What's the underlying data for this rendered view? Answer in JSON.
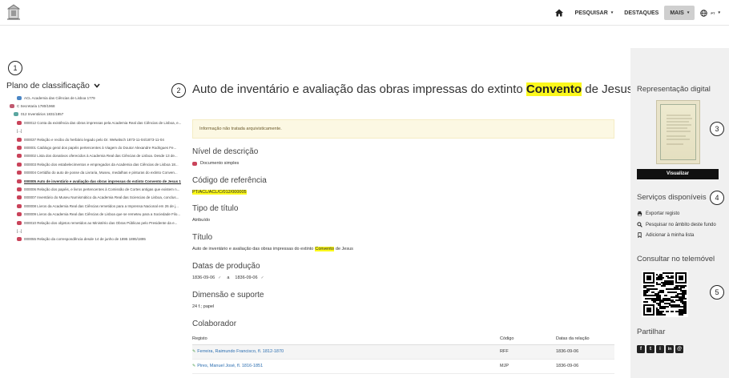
{
  "nav": {
    "items": [
      {
        "label": "PESQUISAR",
        "caret": "▾"
      },
      {
        "label": "DESTAQUES"
      },
      {
        "label": "MAIS",
        "caret": "▾"
      },
      {
        "label": "PT",
        "caret": "▾"
      }
    ]
  },
  "badges": [
    "1",
    "2",
    "3",
    "4",
    "5"
  ],
  "left": {
    "title": "Plano de classificação",
    "tree": [
      {
        "icon": "blue",
        "text": "ACL Academia das Ciências de Lisboa 1779"
      },
      {
        "icon": "pink",
        "text": "C Secretaria 1780/1968"
      },
      {
        "icon": "teal",
        "text": "012 Inventários 1831/1857"
      },
      {
        "icon": "red",
        "text": "000012 Conta da existência das obras impressas pela Academia Real das Ciências de Lisboa, e..."
      },
      {
        "icon": "",
        "text": "[...]"
      },
      {
        "icon": "red",
        "text": "000037 Relação e recibo do herbário legado pelo Dr. Welwitsch 1873-11-04/1873-11-04"
      },
      {
        "icon": "red",
        "text": "000001 Catálogo geral dos papéis pertencentes à Viagem do Doutor Alexandre Rodrigues Fe..."
      },
      {
        "icon": "red",
        "text": "000002 Lista dos donativos oferecidos à Academia Real das Ciências de Lisboa. Desde 13 de..."
      },
      {
        "icon": "red",
        "text": "000003 Relação dos estabelecimentos e empregados da Academia das Ciências de Lisboa 18..."
      },
      {
        "icon": "red",
        "text": "000004 Certidão do auto de posse da Livraria, Museu, medalhas e pinturas do extinto Conven..."
      },
      {
        "icon": "red",
        "text": "000005 Auto de inventário e avaliação das obras impressas do extinto Convento de Jesus 18...",
        "current": true
      },
      {
        "icon": "red",
        "text": "000006 Relação dos papéis, e livros pertencentes à Comissão de Cortes antigas que existem n..."
      },
      {
        "icon": "red",
        "text": "000007 Inventário do Museu Numismático da Academia Real das Sciencias de Lisboa, conclus..."
      },
      {
        "icon": "red",
        "text": "000008 Livros da Academia Real das Ciências remetidos para a Imprensa Nacional em 26 de j..."
      },
      {
        "icon": "red",
        "text": "000009 Livros da Academia Real das Ciências de Lisboa que se remeteu para a Sociedade Filo..."
      },
      {
        "icon": "red",
        "text": "000010 Relação dos objetos remetidos ao Ministério das Obras Públicas pelo Presidente da e..."
      },
      {
        "icon": "",
        "text": "[...]"
      },
      {
        "icon": "red",
        "text": "000055 Relação da correspondência desde 14 de junho de 1895 1895/1895"
      }
    ]
  },
  "main": {
    "title_before": "Auto de inventário e avaliação das obras impressas do extinto",
    "title_highlight": "Convento",
    "title_after": "de Jesus",
    "notice": "Informação não tratada arquivisticamente.",
    "nivel_label": "Nível de descrição",
    "nivel_value": "Documento simples",
    "codigo_label": "Código de referência",
    "codigo_value": "PT/ACL/ACL/C/012/000005",
    "tipo_label": "Tipo de título",
    "tipo_value": "Atribuído",
    "titulo_label": "Título",
    "titulo_before": "Auto de inventário e avaliação das obras impressas do extinto",
    "titulo_highlight": "Convento",
    "titulo_after": "de Jesus",
    "datas_label": "Datas de produção",
    "data_inicio": "1836-09-06",
    "data_sep": "a",
    "data_fim": "1836-09-06",
    "dim_label": "Dimensão e suporte",
    "dim_value": "24 f.; papel",
    "colab_label": "Colaborador",
    "table": {
      "headers": [
        "Registo",
        "Código",
        "Datas da relação"
      ],
      "rows": [
        {
          "registo": "Ferreira, Raimundo Francisco, fl. 1812-1870",
          "codigo": "RFF",
          "datas": "1836-09-06"
        },
        {
          "registo": "Pires, Manuel José, fl. 1816-1851",
          "codigo": "MJP",
          "datas": "1836-09-06"
        }
      ]
    }
  },
  "right": {
    "rep_title": "Representação digital",
    "visualizar": "Visualizar",
    "servicos_title": "Serviços disponíveis",
    "servicos": [
      "Exportar registo",
      "Pesquisar no âmbito deste fundo",
      "Adicionar à minha lista"
    ],
    "telemovel_title": "Consultar no telemóvel",
    "partilhar_title": "Partilhar",
    "share": [
      "f",
      "t",
      "i",
      "in",
      "@"
    ]
  }
}
